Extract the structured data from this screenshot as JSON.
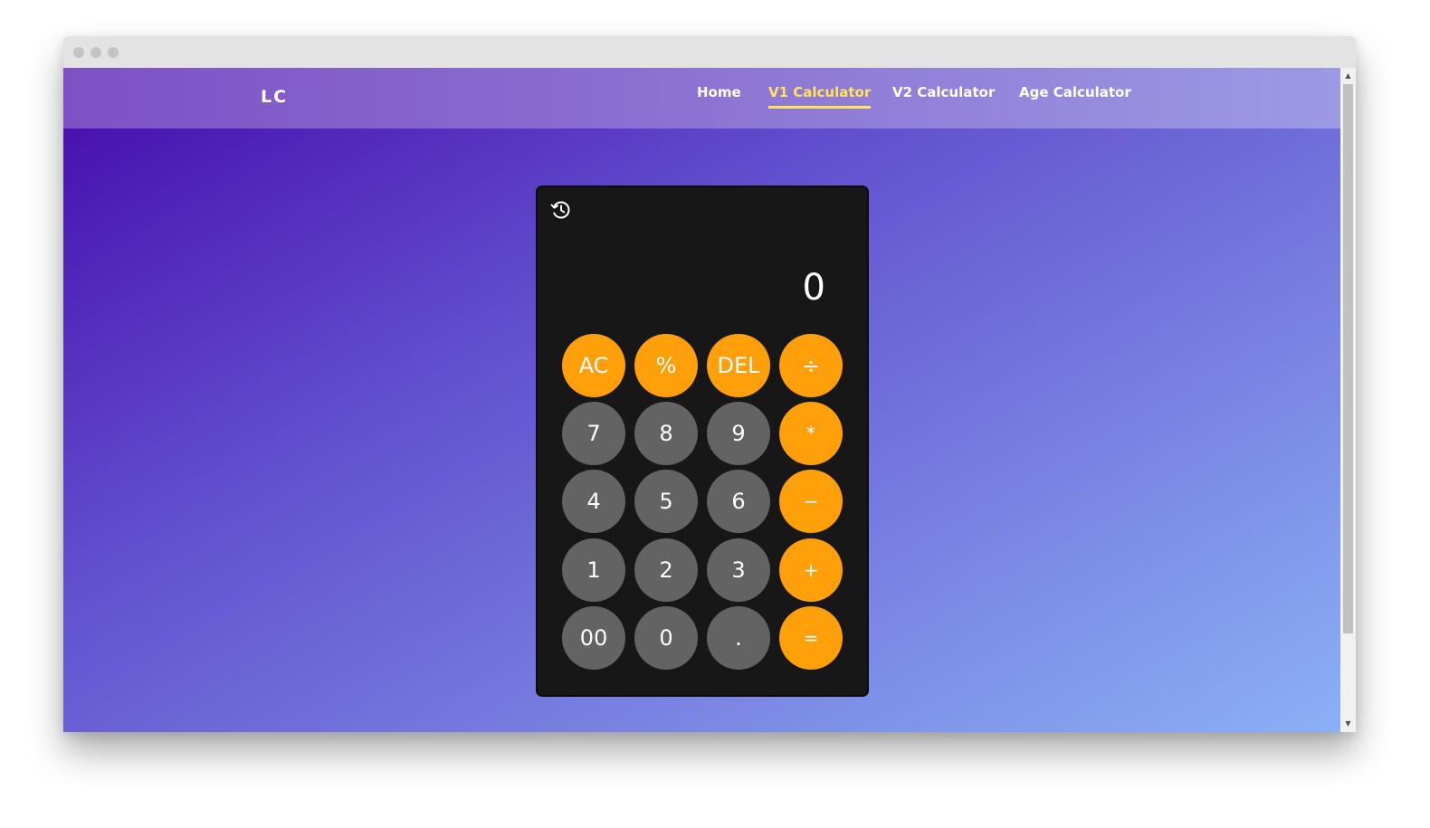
{
  "nav": {
    "logo": "LC",
    "links": [
      "Home",
      "V1 Calculator",
      "V2 Calculator",
      "Age Calculator"
    ],
    "active_link": "V1 Calculator"
  },
  "calculator": {
    "history_icon": "history-icon",
    "display_value": "0",
    "keys": [
      [
        "AC",
        "%",
        "DEL",
        "÷"
      ],
      [
        "7",
        "8",
        "9",
        "*"
      ],
      [
        "4",
        "5",
        "6",
        "−"
      ],
      [
        "1",
        "2",
        "3",
        "+"
      ],
      [
        "00",
        "0",
        ".",
        "="
      ]
    ]
  },
  "colors": {
    "accent_active_link": "#ffe45c",
    "operator_key": "#ff9f0a",
    "number_key": "#636363",
    "calculator_body": "#171717"
  }
}
